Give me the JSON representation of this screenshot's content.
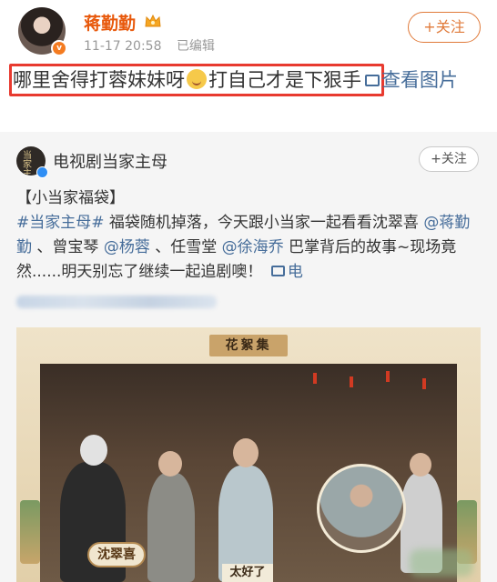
{
  "post": {
    "author_name": "蒋勤勤",
    "timestamp": "11-17 20:58",
    "edited_label": "已编辑",
    "follow_label": "+关注",
    "avatar_badge": "v",
    "text_before_emoji": "哪里舍得打蓉妹妹呀",
    "text_after_emoji": "打自己才是下狠手",
    "view_image_label": "查看图片",
    "crown_icon": "crown-icon",
    "emoji_icon": "laughing-emoji-icon",
    "highlight_color": "#e83a2f",
    "name_color": "#e8590c"
  },
  "repost": {
    "account_name": "电视剧当家主母",
    "avatar_text": "当家主母",
    "follow_label": "+关注",
    "title": "【小当家福袋】",
    "hashtag": "#当家主母#",
    "seg1": " 福袋随机掉落，今天跟小当家一起看看沈翠喜",
    "mention1": "@蒋勤勤",
    "seg2": " 、曾宝琴",
    "mention2": "@杨蓉",
    "seg3": " 、任雪堂",
    "mention3": "@徐海乔",
    "seg4": " 巴掌背后的故事~现场竟然......明天别忘了继续一起追剧噢！",
    "video_label": "电",
    "link_color": "#466d9a"
  },
  "media": {
    "frame_title": "花絮集",
    "name_tag": "沈翠喜",
    "caption": "太好了"
  }
}
